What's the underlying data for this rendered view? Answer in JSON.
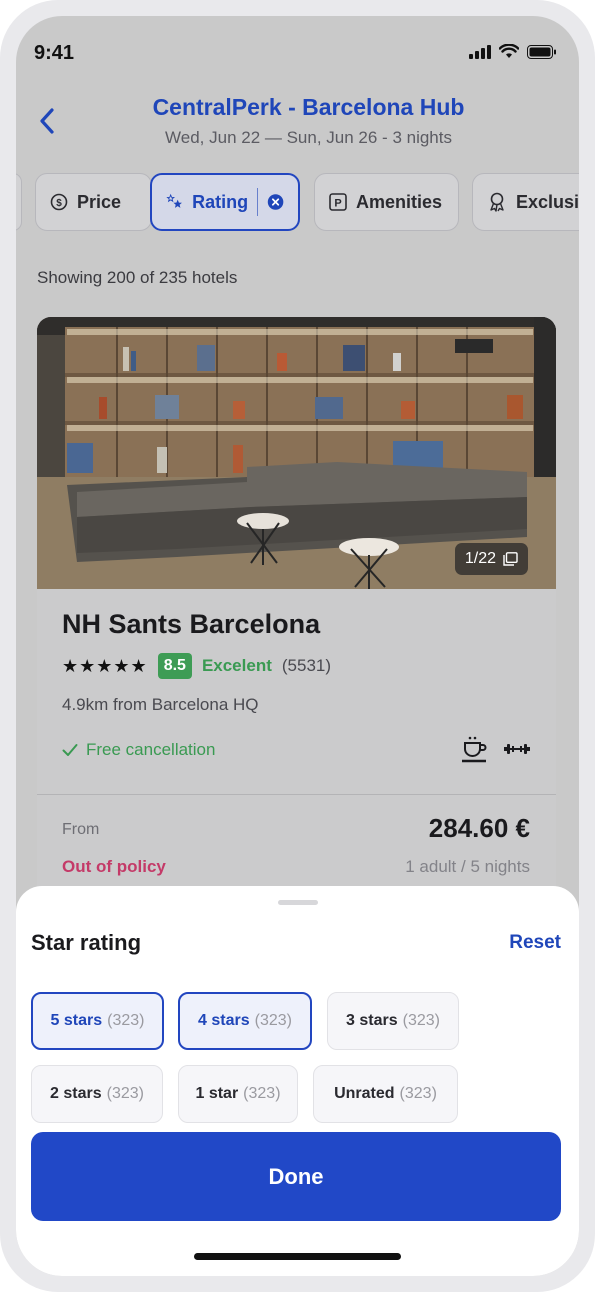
{
  "status": {
    "time": "9:41"
  },
  "header": {
    "title": "CentralPerk - Barcelona Hub",
    "subtitle": "Wed, Jun 22 — Sun, Jun 26 - 3 nights"
  },
  "filters": {
    "chips": [
      {
        "label": "Price",
        "icon": "price-icon",
        "active": false
      },
      {
        "label": "Rating",
        "icon": "stars-icon",
        "active": true
      },
      {
        "label": "Amenities",
        "icon": "parking-icon",
        "active": false
      },
      {
        "label": "Exclusi",
        "icon": "award-icon",
        "active": false
      }
    ]
  },
  "results": {
    "showing": "Showing 200 of 235 hotels"
  },
  "hotel": {
    "photo_counter": "1/22",
    "name": "NH Sants Barcelona",
    "stars": "★★★★★",
    "star_count": 5,
    "score": "8.5",
    "score_label": "Excelent",
    "reviews": "(5531)",
    "distance": "4.9km from Barcelona HQ",
    "cancellation": "Free cancellation",
    "amenities": [
      "breakfast-icon",
      "gym-icon"
    ],
    "price_prefix": "From",
    "price": "284.60 €",
    "policy": "Out of policy",
    "guests": "1 adult / 5 nights"
  },
  "sheet": {
    "title": "Star rating",
    "reset": "Reset",
    "options": [
      {
        "label": "5 stars",
        "count": "(323)",
        "selected": true
      },
      {
        "label": "4 stars",
        "count": "(323)",
        "selected": true
      },
      {
        "label": "3 stars",
        "count": "(323)",
        "selected": false
      },
      {
        "label": "2 stars",
        "count": "(323)",
        "selected": false
      },
      {
        "label": "1 star",
        "count": "(323)",
        "selected": false
      },
      {
        "label": "Unrated",
        "count": "(323)",
        "selected": false
      }
    ],
    "done": "Done"
  },
  "colors": {
    "accent": "#2148c7",
    "good": "#3e9c55",
    "policy": "#c43a68"
  }
}
